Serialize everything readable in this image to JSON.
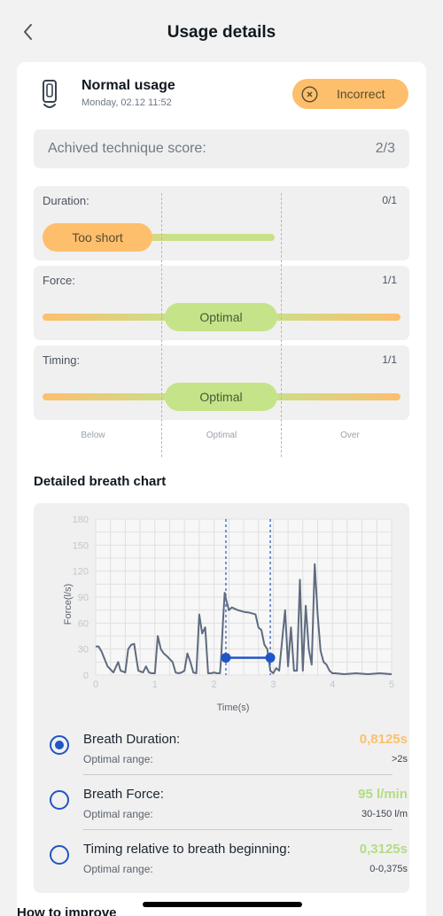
{
  "header": {
    "title": "Usage details",
    "back_icon": "chevron-left-icon"
  },
  "usage": {
    "title": "Normal usage",
    "date": "Monday, 02.12 11:52",
    "device_icon": "inhaler-icon",
    "status": {
      "label": "Incorrect",
      "icon": "close-circle-icon",
      "color": "#fdbf6c"
    }
  },
  "score": {
    "label": "Achived technique score:",
    "value": "2/3"
  },
  "metrics": [
    {
      "label": "Duration:",
      "score": "0/1",
      "result": "Too short",
      "result_color": "#fdbf6c"
    },
    {
      "label": "Force:",
      "score": "1/1",
      "result": "Optimal",
      "result_color": "#c5e48a"
    },
    {
      "label": "Timing:",
      "score": "1/1",
      "result": "Optimal",
      "result_color": "#c5e48a"
    }
  ],
  "zones": [
    "Below",
    "Optimal",
    "Over"
  ],
  "chart_section_title": "Detailed breath chart",
  "chart_data": {
    "type": "line",
    "xlabel": "Time(s)",
    "ylabel": "Force(l/s)",
    "xlim": [
      0,
      5
    ],
    "ylim": [
      0,
      180
    ],
    "xticks": [
      "0",
      "1",
      "2",
      "3",
      "4",
      "5"
    ],
    "yticks": [
      "0",
      "30",
      "60",
      "90",
      "120",
      "150",
      "180"
    ],
    "grid": true,
    "series": [
      {
        "x": [
          0,
          0.05,
          0.1,
          0.2,
          0.3,
          0.38,
          0.42,
          0.5,
          0.55,
          0.6,
          0.65,
          0.72,
          0.8,
          0.85,
          0.9,
          0.95,
          1.0,
          1.05,
          1.1,
          1.15,
          1.2,
          1.3,
          1.35,
          1.4,
          1.45,
          1.5,
          1.55,
          1.6,
          1.65,
          1.7,
          1.75,
          1.8,
          1.85,
          1.9,
          1.95,
          2.0,
          2.05,
          2.1,
          2.12,
          2.15,
          2.18,
          2.2,
          2.25,
          2.3,
          2.4,
          2.5,
          2.6,
          2.7,
          2.75,
          2.8,
          2.85,
          2.9,
          2.95,
          3.0,
          3.05,
          3.1,
          3.2,
          3.25,
          3.3,
          3.35,
          3.4,
          3.45,
          3.5,
          3.55,
          3.6,
          3.65,
          3.7,
          3.75,
          3.8,
          3.85,
          3.9,
          3.95,
          4.0,
          4.05,
          4.2,
          4.4,
          4.6,
          4.8,
          5.0
        ],
        "y": [
          33,
          33,
          27,
          10,
          3,
          15,
          5,
          3,
          30,
          35,
          36,
          5,
          3,
          10,
          3,
          2,
          2,
          45,
          30,
          25,
          22,
          15,
          3,
          2,
          3,
          5,
          25,
          15,
          3,
          2,
          70,
          48,
          55,
          2,
          2,
          3,
          2,
          2,
          20,
          60,
          95,
          88,
          75,
          78,
          75,
          73,
          72,
          70,
          55,
          52,
          35,
          30,
          5,
          2,
          8,
          5,
          75,
          10,
          55,
          5,
          5,
          110,
          5,
          80,
          30,
          12,
          128,
          70,
          28,
          15,
          12,
          5,
          2,
          2,
          1,
          2,
          1,
          2,
          1
        ]
      }
    ],
    "markers": {
      "start": 2.2,
      "end": 2.95,
      "level": 20
    }
  },
  "options": [
    {
      "label": "Breath Duration:",
      "sub": "Optimal range:",
      "value": "0,8125s",
      "range": ">2s",
      "color": "#fdbf6c",
      "selected": true
    },
    {
      "label": "Breath Force:",
      "sub": "Optimal range:",
      "value": "95 l/min",
      "range": "30-150 l/m",
      "color": "#b3dc83",
      "selected": false
    },
    {
      "label": "Timing relative to breath beginning:",
      "sub": "Optimal range:",
      "value": "0,3125s",
      "range": "0-0,375s",
      "color": "#b3dc83",
      "selected": false
    }
  ],
  "next_section_title": "How to improve"
}
